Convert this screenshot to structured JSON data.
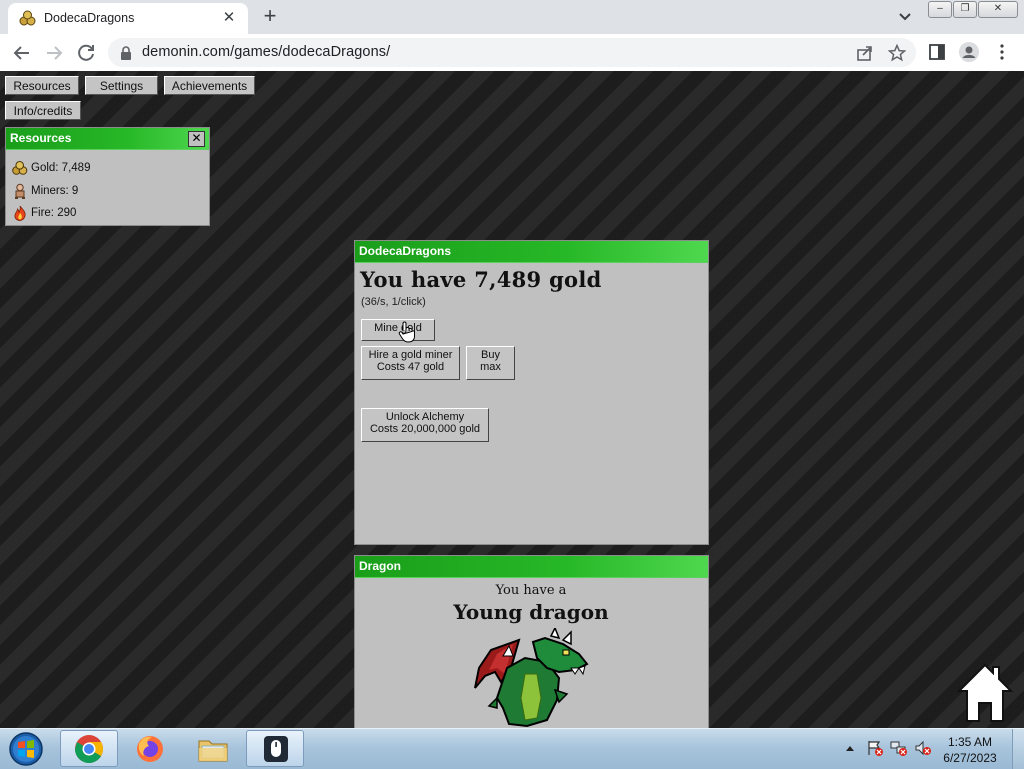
{
  "browser": {
    "tab_title": "DodecaDragons",
    "url": "demonin.com/games/dodecaDragons/",
    "window_buttons": {
      "minimize": "–",
      "restore": "❐",
      "close": "✕"
    }
  },
  "nav": {
    "resources": "Resources",
    "settings": "Settings",
    "achievements": "Achievements",
    "info": "Info/credits"
  },
  "resources_panel": {
    "title": "Resources",
    "close": "✕",
    "gold": "Gold: 7,489",
    "miners": "Miners: 9",
    "fire": "Fire: 290"
  },
  "main_panel": {
    "title": "DodecaDragons",
    "gold_heading": "You have 7,489 gold",
    "rate": "(36/s, 1/click)",
    "mine_button": "Mine gold",
    "hire_line1": "Hire a gold miner",
    "hire_line2": "Costs 47 gold",
    "buy_max_line1": "Buy",
    "buy_max_line2": "max",
    "alchemy_line1": "Unlock Alchemy",
    "alchemy_line2": "Costs 20,000,000 gold"
  },
  "dragon_panel": {
    "title": "Dragon",
    "subtitle": "You have a",
    "dragon_name": "Young dragon"
  },
  "taskbar": {
    "time": "1:35 AM",
    "date": "6/27/2023"
  },
  "colors": {
    "title_bar_green": "#1a9e1a",
    "panel_gray": "#c0c0c0",
    "background_dark": "#2a2a2a"
  }
}
